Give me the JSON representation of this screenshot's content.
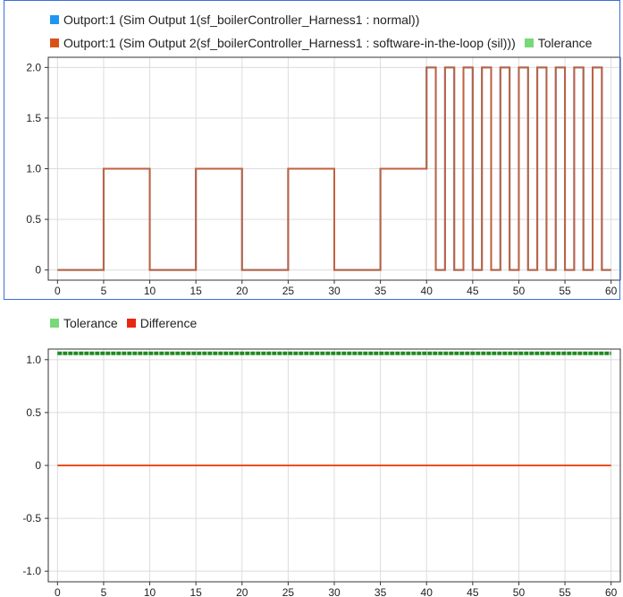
{
  "top": {
    "legend": [
      {
        "label": "Outport:1 (Sim Output 1(sf_boilerController_Harness1 : normal))",
        "color": "#1e96f0"
      },
      {
        "label": "Outport:1 (Sim Output 2(sf_boilerController_Harness1 : software-in-the-loop (sil)))",
        "color": "#d95319"
      },
      {
        "label": "Tolerance",
        "color": "#77d977"
      }
    ]
  },
  "bottom": {
    "legend": [
      {
        "label": "Tolerance",
        "color": "#77d977"
      },
      {
        "label": "Difference",
        "color": "#e8270e"
      }
    ]
  },
  "chart_data": [
    {
      "type": "line",
      "title": "",
      "xlabel": "",
      "ylabel": "",
      "xlim": [
        -1,
        61
      ],
      "ylim": [
        -0.1,
        2.1
      ],
      "xticks": [
        0,
        5,
        10,
        15,
        20,
        25,
        30,
        35,
        40,
        45,
        50,
        55,
        60
      ],
      "yticks": [
        0,
        0.5,
        1.0,
        1.5,
        2.0
      ],
      "ytick_labels": [
        "0",
        "0.5",
        "1.0",
        "1.5",
        "2.0"
      ],
      "grid": true,
      "step": true,
      "series": [
        {
          "name": "Outport:1 (Sim Output 1(sf_boilerController_Harness1 : normal))",
          "color": "#1e96f0",
          "x": [
            0,
            5,
            10,
            15,
            20,
            25,
            30,
            35,
            40,
            41,
            42,
            43,
            44,
            45,
            46,
            47,
            48,
            49,
            50,
            51,
            52,
            53,
            54,
            55,
            56,
            57,
            58,
            59,
            60
          ],
          "y": [
            0,
            1,
            0,
            1,
            0,
            1,
            0,
            1,
            2,
            0,
            2,
            0,
            2,
            0,
            2,
            0,
            2,
            0,
            2,
            0,
            2,
            0,
            2,
            0,
            2,
            0,
            2,
            0,
            0
          ]
        },
        {
          "name": "Outport:1 (Sim Output 2(sf_boilerController_Harness1 : software-in-the-loop (sil)))",
          "color": "#c0613f",
          "x": [
            0,
            5,
            10,
            15,
            20,
            25,
            30,
            35,
            40,
            41,
            42,
            43,
            44,
            45,
            46,
            47,
            48,
            49,
            50,
            51,
            52,
            53,
            54,
            55,
            56,
            57,
            58,
            59,
            60
          ],
          "y": [
            0,
            1,
            0,
            1,
            0,
            1,
            0,
            1,
            2,
            0,
            2,
            0,
            2,
            0,
            2,
            0,
            2,
            0,
            2,
            0,
            2,
            0,
            2,
            0,
            2,
            0,
            2,
            0,
            0
          ]
        }
      ]
    },
    {
      "type": "line",
      "title": "",
      "xlabel": "",
      "ylabel": "",
      "xlim": [
        -1,
        61
      ],
      "ylim": [
        -1.1,
        1.1
      ],
      "xticks": [
        0,
        5,
        10,
        15,
        20,
        25,
        30,
        35,
        40,
        45,
        50,
        55,
        60
      ],
      "yticks": [
        -1.0,
        -0.5,
        0,
        0.5,
        1.0
      ],
      "ytick_labels": [
        "-1.0",
        "-0.5",
        "0",
        "0.5",
        "1.0"
      ],
      "grid": true,
      "series": [
        {
          "name": "Tolerance",
          "color": "#1f8a1f",
          "x": [
            0,
            60
          ],
          "y": [
            1.06,
            1.06
          ]
        },
        {
          "name": "Difference",
          "color": "#e8501c",
          "x": [
            0,
            60
          ],
          "y": [
            0,
            0
          ]
        }
      ]
    }
  ]
}
